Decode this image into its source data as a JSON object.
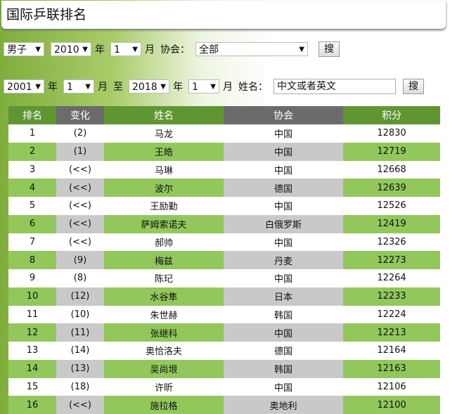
{
  "title": "国际乒联排名",
  "filter1": {
    "gender": "男子",
    "year": "2010",
    "year_label": "年",
    "month": "1",
    "month_label": "月",
    "assoc_label": "协会：",
    "assoc": "全部",
    "search": "搜"
  },
  "filter2": {
    "from_year": "2001",
    "year_label": "年",
    "from_month": "1",
    "month_label": "月",
    "to_label": "至",
    "to_year": "2018",
    "to_month": "1",
    "name_label": "姓名：",
    "name_value": "中文或者英文",
    "search": "搜"
  },
  "table": {
    "headers": [
      "排名",
      "变化",
      "姓名",
      "协会",
      "积分"
    ],
    "rows": [
      [
        "1",
        "(2)",
        "马龙",
        "中国",
        "12830"
      ],
      [
        "2",
        "(1)",
        "王皓",
        "中国",
        "12719"
      ],
      [
        "3",
        "(<<)",
        "马琳",
        "中国",
        "12668"
      ],
      [
        "4",
        "(<<)",
        "波尔",
        "德国",
        "12639"
      ],
      [
        "5",
        "(<<)",
        "王励勤",
        "中国",
        "12526"
      ],
      [
        "6",
        "(<<)",
        "萨姆索诺夫",
        "白俄罗斯",
        "12419"
      ],
      [
        "7",
        "(<<)",
        "郝帅",
        "中国",
        "12326"
      ],
      [
        "8",
        "(9)",
        "梅兹",
        "丹麦",
        "12273"
      ],
      [
        "9",
        "(8)",
        "陈玘",
        "中国",
        "12264"
      ],
      [
        "10",
        "(12)",
        "水谷隼",
        "日本",
        "12233"
      ],
      [
        "11",
        "(10)",
        "朱世赫",
        "韩国",
        "12224"
      ],
      [
        "12",
        "(11)",
        "张继科",
        "中国",
        "12213"
      ],
      [
        "13",
        "(14)",
        "奥恰洛夫",
        "德国",
        "12164"
      ],
      [
        "14",
        "(13)",
        "吴尚垠",
        "韩国",
        "12163"
      ],
      [
        "15",
        "(18)",
        "许昕",
        "中国",
        "12106"
      ],
      [
        "16",
        "(<<)",
        "施拉格",
        "奥地利",
        "12100"
      ]
    ]
  }
}
